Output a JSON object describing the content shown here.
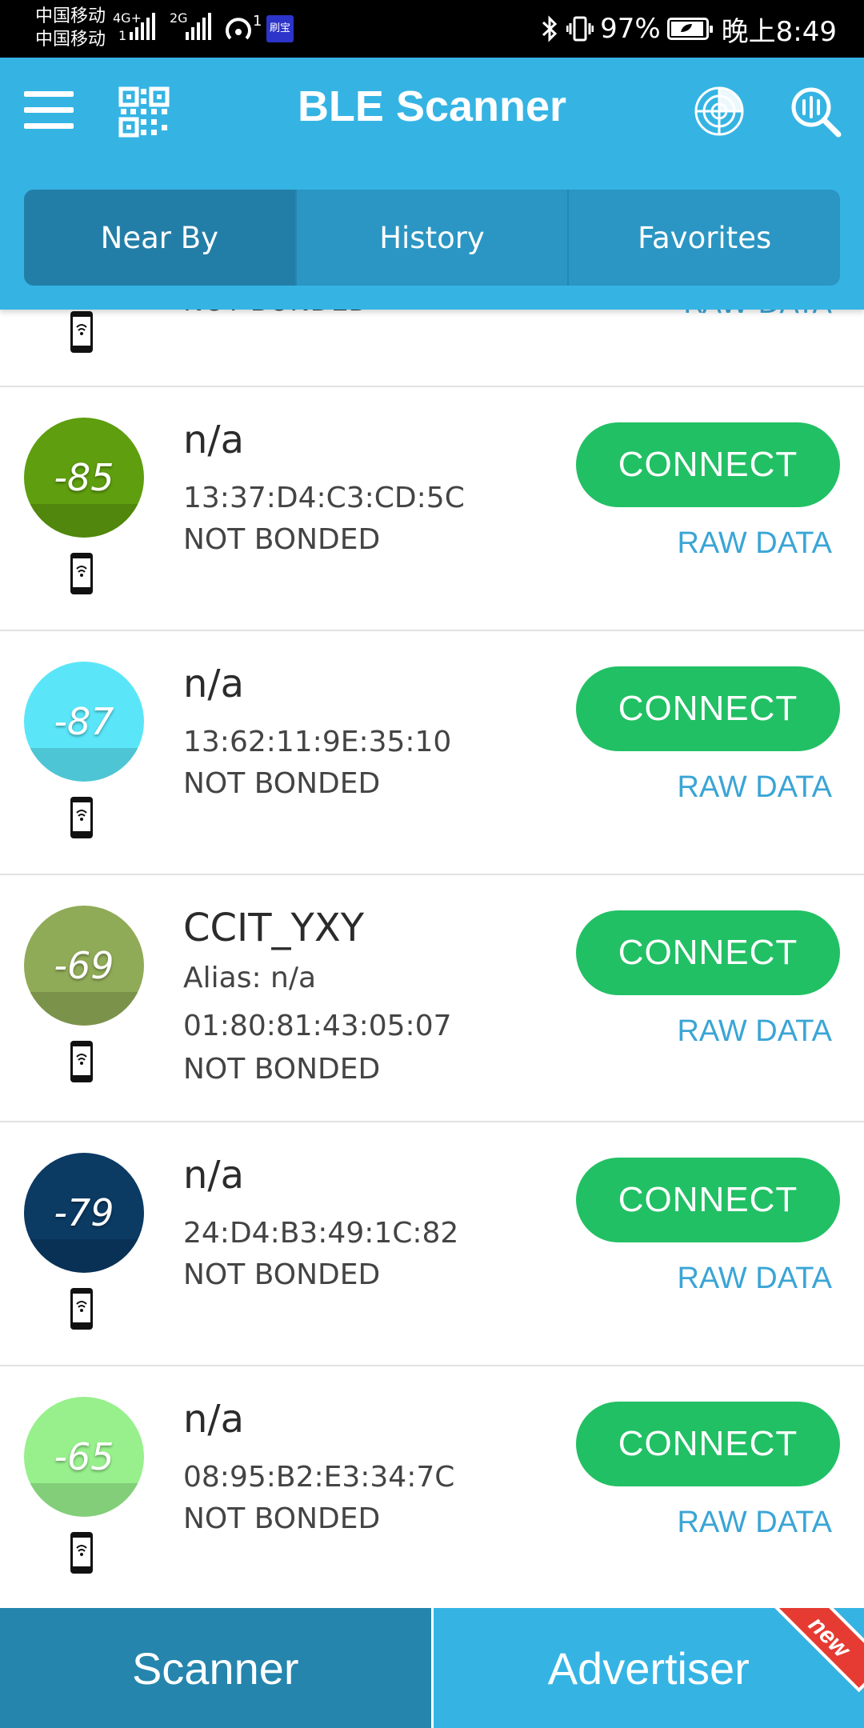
{
  "status_bar": {
    "carrier1": "中国移动",
    "carrier2": "中国移动",
    "net1": "4G+",
    "net1_sub": "1",
    "net2": "2G",
    "hotspot_count": "1",
    "app_badge": "刷宝",
    "battery_percent": "97%",
    "battery_level": 0.97,
    "time": "晚上8:49"
  },
  "header": {
    "title": "BLE Scanner",
    "tabs": [
      {
        "label": "Near By",
        "active": true
      },
      {
        "label": "History",
        "active": false
      },
      {
        "label": "Favorites",
        "active": false
      }
    ]
  },
  "partial_row": {
    "status": "NOT BONDED",
    "raw_label": "RAW DATA"
  },
  "devices": [
    {
      "rssi": "-85",
      "color": "#5e9e0f",
      "name": "n/a",
      "alias": "",
      "address": "13:37:D4:C3:CD:5C",
      "bond": "NOT BONDED",
      "connect_label": "CONNECT",
      "raw_label": "RAW DATA"
    },
    {
      "rssi": "-87",
      "color": "#5ae6f8",
      "name": "n/a",
      "alias": "",
      "address": "13:62:11:9E:35:10",
      "bond": "NOT BONDED",
      "connect_label": "CONNECT",
      "raw_label": "RAW DATA"
    },
    {
      "rssi": "-69",
      "color": "#90ab58",
      "name": "CCIT_YXY",
      "alias": "Alias: n/a",
      "address": "01:80:81:43:05:07",
      "bond": "NOT BONDED",
      "connect_label": "CONNECT",
      "raw_label": "RAW DATA"
    },
    {
      "rssi": "-79",
      "color": "#0b3a63",
      "name": "n/a",
      "alias": "",
      "address": "24:D4:B3:49:1C:82",
      "bond": "NOT BONDED",
      "connect_label": "CONNECT",
      "raw_label": "RAW DATA"
    },
    {
      "rssi": "-65",
      "color": "#98f08d",
      "name": "n/a",
      "alias": "",
      "address": "08:95:B2:E3:34:7C",
      "bond": "NOT BONDED",
      "connect_label": "CONNECT",
      "raw_label": "RAW DATA"
    }
  ],
  "bottom_nav": {
    "scanner_label": "Scanner",
    "advertiser_label": "Advertiser",
    "new_badge": "new"
  }
}
